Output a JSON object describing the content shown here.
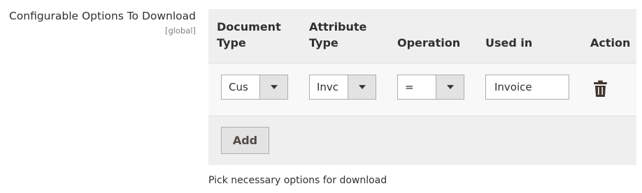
{
  "field": {
    "label": "Configurable Options To Download",
    "scope": "[global]",
    "note": "Pick necessary options for download"
  },
  "table": {
    "headers": {
      "document_type_line1": "Document",
      "document_type_line2": "Type",
      "attribute_type_line1": "Attribute",
      "attribute_type_line2": "Type",
      "operation": "Operation",
      "used_in": "Used in",
      "action": "Action"
    },
    "rows": [
      {
        "document_type": "Cus",
        "attribute_type": "Invc",
        "operation": "=",
        "used_in": "Invoice",
        "action_icon": "trash-icon"
      }
    ],
    "add_label": "Add"
  }
}
